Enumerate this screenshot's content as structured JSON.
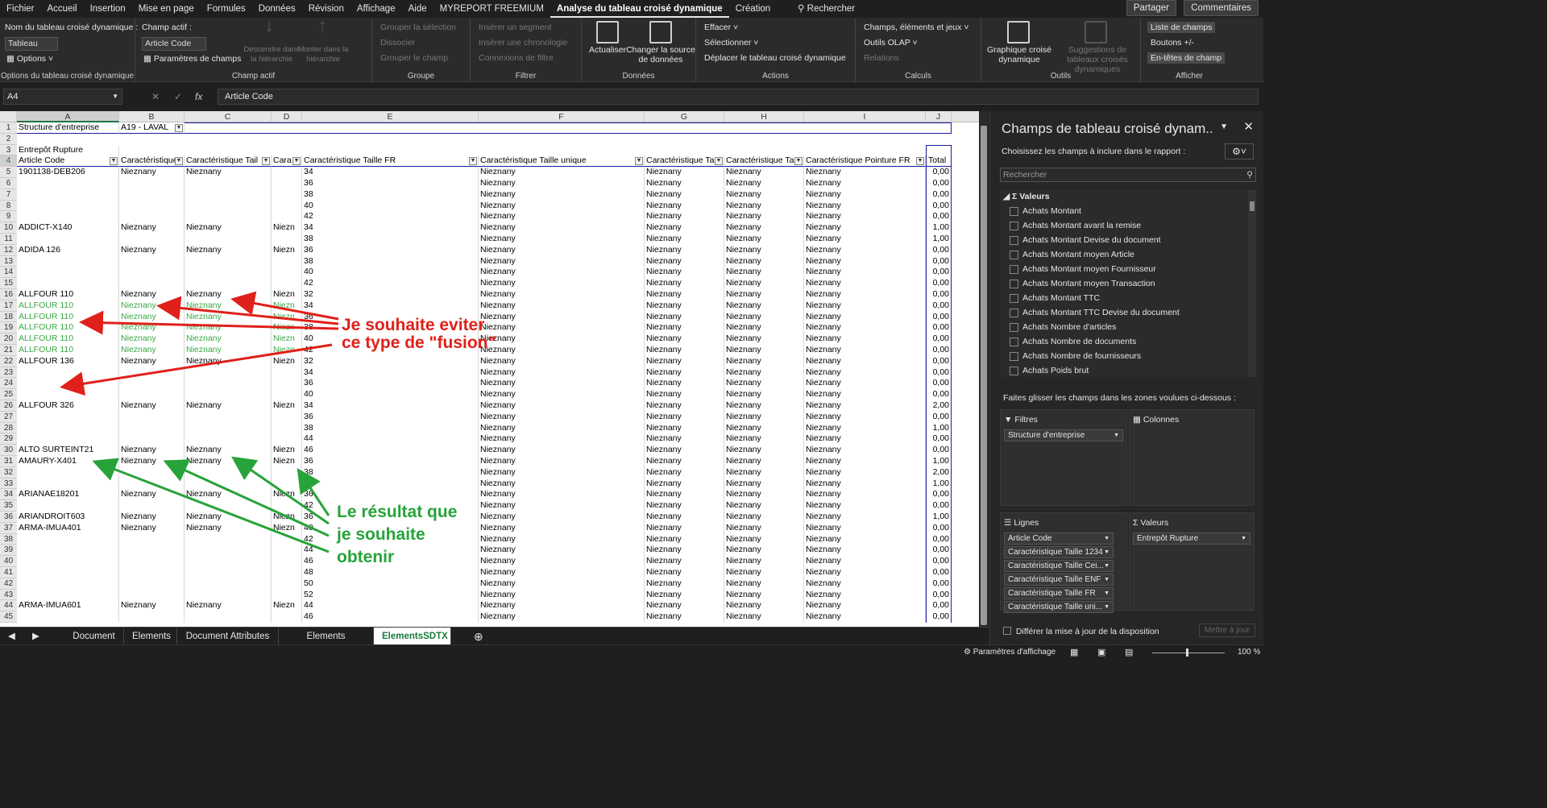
{
  "menu": [
    "Fichier",
    "Accueil",
    "Insertion",
    "Mise en page",
    "Formules",
    "Données",
    "Révision",
    "Affichage",
    "Aide",
    "MYREPORT FREEMIUM",
    "Analyse du tableau croisé dynamique",
    "Création"
  ],
  "menu_active_index": 10,
  "search_label": "Rechercher",
  "share_label": "Partager",
  "comments_label": "Commentaires",
  "ribbon": {
    "pivot_name_label": "Nom du tableau croisé dynamique :",
    "pivot_name_value": "Tableau croisé",
    "options_label": "Options",
    "group1_label": "Options du tableau croisé dynamique",
    "active_field_label": "Champ actif :",
    "active_field_value": "Article Code",
    "field_settings_label": "Paramètres de champs",
    "drill_down_label": "Descendre dans la hiérarchie",
    "drill_up_label": "Monter dans la hiérarchie",
    "group2_label": "Champ actif",
    "group_selection": "Grouper la sélection",
    "ungroup": "Dissocier",
    "group_field": "Grouper le champ",
    "group3_label": "Groupe",
    "insert_slicer": "Insérer un segment",
    "insert_timeline": "Insérer une chronologie",
    "filter_connections": "Connexions de filtre",
    "group4_label": "Filtrer",
    "refresh": "Actualiser",
    "change_source": "Changer la source de données",
    "group5_label": "Données",
    "clear": "Effacer",
    "select": "Sélectionner",
    "move_pivot": "Déplacer le tableau croisé dynamique",
    "group6_label": "Actions",
    "fields_items_sets": "Champs, éléments et jeux",
    "olap_tools": "Outils OLAP",
    "relations": "Relations",
    "group7_label": "Calculs",
    "pivot_chart": "Graphique croisé dynamique",
    "recommended_pivots": "Suggestions de tableaux croisés dynamiques",
    "group8_label": "Outils",
    "field_list": "Liste de champs",
    "buttons_pm": "Boutons +/-",
    "field_headers": "En-têtes de champ",
    "group9_label": "Afficher"
  },
  "formula_bar": {
    "name_box": "A4",
    "formula": "Article Code"
  },
  "columns": [
    "A",
    "B",
    "C",
    "D",
    "E",
    "F",
    "G",
    "H",
    "I",
    "J"
  ],
  "filter_row": {
    "label": "Structure d'entreprise",
    "value": "A19 - LAVAL"
  },
  "values_label": "Entrepôt Rupture",
  "header_row": [
    "Article Code",
    "Caractéristique",
    "Caractéristique Tail",
    "Cara",
    "Caractéristique Taille FR",
    "Caractéristique Taille unique",
    "Caractéristique Ta",
    "Caractéristique Ta",
    "Caractéristique Pointure FR",
    "Total"
  ],
  "rows": [
    {
      "n": 5,
      "a": "1901138-DEB206",
      "b": "Nieznany",
      "c": "Nieznany",
      "d": "",
      "e": "34",
      "f": "Nieznany",
      "g": "Nieznany",
      "h": "Nieznany",
      "i": "Nieznany",
      "t": "0,00"
    },
    {
      "n": 6,
      "a": "",
      "b": "",
      "c": "",
      "d": "",
      "e": "36",
      "f": "Nieznany",
      "g": "Nieznany",
      "h": "Nieznany",
      "i": "Nieznany",
      "t": "0,00"
    },
    {
      "n": 7,
      "a": "",
      "b": "",
      "c": "",
      "d": "",
      "e": "38",
      "f": "Nieznany",
      "g": "Nieznany",
      "h": "Nieznany",
      "i": "Nieznany",
      "t": "0,00"
    },
    {
      "n": 8,
      "a": "",
      "b": "",
      "c": "",
      "d": "",
      "e": "40",
      "f": "Nieznany",
      "g": "Nieznany",
      "h": "Nieznany",
      "i": "Nieznany",
      "t": "0,00"
    },
    {
      "n": 9,
      "a": "",
      "b": "",
      "c": "",
      "d": "",
      "e": "42",
      "f": "Nieznany",
      "g": "Nieznany",
      "h": "Nieznany",
      "i": "Nieznany",
      "t": "0,00"
    },
    {
      "n": 10,
      "a": "ADDICT-X140",
      "b": "Nieznany",
      "c": "Nieznany",
      "d": "Niezn",
      "e": "34",
      "f": "Nieznany",
      "g": "Nieznany",
      "h": "Nieznany",
      "i": "Nieznany",
      "t": "1,00"
    },
    {
      "n": 11,
      "a": "",
      "b": "",
      "c": "",
      "d": "",
      "e": "38",
      "f": "Nieznany",
      "g": "Nieznany",
      "h": "Nieznany",
      "i": "Nieznany",
      "t": "1,00"
    },
    {
      "n": 12,
      "a": "ADIDA 126",
      "b": "Nieznany",
      "c": "Nieznany",
      "d": "Niezn",
      "e": "36",
      "f": "Nieznany",
      "g": "Nieznany",
      "h": "Nieznany",
      "i": "Nieznany",
      "t": "0,00"
    },
    {
      "n": 13,
      "a": "",
      "b": "",
      "c": "",
      "d": "",
      "e": "38",
      "f": "Nieznany",
      "g": "Nieznany",
      "h": "Nieznany",
      "i": "Nieznany",
      "t": "0,00"
    },
    {
      "n": 14,
      "a": "",
      "b": "",
      "c": "",
      "d": "",
      "e": "40",
      "f": "Nieznany",
      "g": "Nieznany",
      "h": "Nieznany",
      "i": "Nieznany",
      "t": "0,00"
    },
    {
      "n": 15,
      "a": "",
      "b": "",
      "c": "",
      "d": "",
      "e": "42",
      "f": "Nieznany",
      "g": "Nieznany",
      "h": "Nieznany",
      "i": "Nieznany",
      "t": "0,00"
    },
    {
      "n": 16,
      "a": "ALLFOUR 110",
      "b": "Nieznany",
      "c": "Nieznany",
      "d": "Niezn",
      "e": "32",
      "f": "Nieznany",
      "g": "Nieznany",
      "h": "Nieznany",
      "i": "Nieznany",
      "t": "0,00"
    },
    {
      "n": 17,
      "a": "ALLFOUR 110",
      "b": "Nieznany",
      "c": "Nieznany",
      "d": "Niezn",
      "e": "34",
      "f": "Nieznany",
      "g": "Nieznany",
      "h": "Nieznany",
      "i": "Nieznany",
      "t": "0,00",
      "green": true
    },
    {
      "n": 18,
      "a": "ALLFOUR 110",
      "b": "Nieznany",
      "c": "Nieznany",
      "d": "Niezn",
      "e": "36",
      "f": "Nieznany",
      "g": "Nieznany",
      "h": "Nieznany",
      "i": "Nieznany",
      "t": "0,00",
      "green": true
    },
    {
      "n": 19,
      "a": "ALLFOUR 110",
      "b": "Nieznany",
      "c": "Nieznany",
      "d": "Niezn",
      "e": "38",
      "f": "Nieznany",
      "g": "Nieznany",
      "h": "Nieznany",
      "i": "Nieznany",
      "t": "0,00",
      "green": true
    },
    {
      "n": 20,
      "a": "ALLFOUR 110",
      "b": "Nieznany",
      "c": "Nieznany",
      "d": "Niezn",
      "e": "40",
      "f": "Nieznany",
      "g": "Nieznany",
      "h": "Nieznany",
      "i": "Nieznany",
      "t": "0,00",
      "green": true
    },
    {
      "n": 21,
      "a": "ALLFOUR 110",
      "b": "Nieznany",
      "c": "Nieznany",
      "d": "Niezn",
      "e": "42",
      "f": "Nieznany",
      "g": "Nieznany",
      "h": "Nieznany",
      "i": "Nieznany",
      "t": "0,00",
      "green": true
    },
    {
      "n": 22,
      "a": "ALLFOUR 136",
      "b": "Nieznany",
      "c": "Nieznany",
      "d": "Niezn",
      "e": "32",
      "f": "Nieznany",
      "g": "Nieznany",
      "h": "Nieznany",
      "i": "Nieznany",
      "t": "0,00"
    },
    {
      "n": 23,
      "a": "",
      "b": "",
      "c": "",
      "d": "",
      "e": "34",
      "f": "Nieznany",
      "g": "Nieznany",
      "h": "Nieznany",
      "i": "Nieznany",
      "t": "0,00"
    },
    {
      "n": 24,
      "a": "",
      "b": "",
      "c": "",
      "d": "",
      "e": "36",
      "f": "Nieznany",
      "g": "Nieznany",
      "h": "Nieznany",
      "i": "Nieznany",
      "t": "0,00"
    },
    {
      "n": 25,
      "a": "",
      "b": "",
      "c": "",
      "d": "",
      "e": "40",
      "f": "Nieznany",
      "g": "Nieznany",
      "h": "Nieznany",
      "i": "Nieznany",
      "t": "0,00"
    },
    {
      "n": 26,
      "a": "ALLFOUR 326",
      "b": "Nieznany",
      "c": "Nieznany",
      "d": "Niezn",
      "e": "34",
      "f": "Nieznany",
      "g": "Nieznany",
      "h": "Nieznany",
      "i": "Nieznany",
      "t": "2,00"
    },
    {
      "n": 27,
      "a": "",
      "b": "",
      "c": "",
      "d": "",
      "e": "36",
      "f": "Nieznany",
      "g": "Nieznany",
      "h": "Nieznany",
      "i": "Nieznany",
      "t": "0,00"
    },
    {
      "n": 28,
      "a": "",
      "b": "",
      "c": "",
      "d": "",
      "e": "38",
      "f": "Nieznany",
      "g": "Nieznany",
      "h": "Nieznany",
      "i": "Nieznany",
      "t": "1,00"
    },
    {
      "n": 29,
      "a": "",
      "b": "",
      "c": "",
      "d": "",
      "e": "44",
      "f": "Nieznany",
      "g": "Nieznany",
      "h": "Nieznany",
      "i": "Nieznany",
      "t": "0,00"
    },
    {
      "n": 30,
      "a": "ALTO SURTEINT21",
      "b": "Nieznany",
      "c": "Nieznany",
      "d": "Niezn",
      "e": "46",
      "f": "Nieznany",
      "g": "Nieznany",
      "h": "Nieznany",
      "i": "Nieznany",
      "t": "0,00"
    },
    {
      "n": 31,
      "a": "AMAURY-X401",
      "b": "Nieznany",
      "c": "Nieznany",
      "d": "Niezn",
      "e": "36",
      "f": "Nieznany",
      "g": "Nieznany",
      "h": "Nieznany",
      "i": "Nieznany",
      "t": "1,00"
    },
    {
      "n": 32,
      "a": "",
      "b": "",
      "c": "",
      "d": "",
      "e": "38",
      "f": "Nieznany",
      "g": "Nieznany",
      "h": "Nieznany",
      "i": "Nieznany",
      "t": "2,00"
    },
    {
      "n": 33,
      "a": "",
      "b": "",
      "c": "",
      "d": "",
      "e": "48",
      "f": "Nieznany",
      "g": "Nieznany",
      "h": "Nieznany",
      "i": "Nieznany",
      "t": "1,00"
    },
    {
      "n": 34,
      "a": "ARIANAE18201",
      "b": "Nieznany",
      "c": "Nieznany",
      "d": "Niezn",
      "e": "36",
      "f": "Nieznany",
      "g": "Nieznany",
      "h": "Nieznany",
      "i": "Nieznany",
      "t": "0,00"
    },
    {
      "n": 35,
      "a": "",
      "b": "",
      "c": "",
      "d": "",
      "e": "42",
      "f": "Nieznany",
      "g": "Nieznany",
      "h": "Nieznany",
      "i": "Nieznany",
      "t": "0,00"
    },
    {
      "n": 36,
      "a": "ARIANDROIT603",
      "b": "Nieznany",
      "c": "Nieznany",
      "d": "Niezn",
      "e": "36",
      "f": "Nieznany",
      "g": "Nieznany",
      "h": "Nieznany",
      "i": "Nieznany",
      "t": "1,00"
    },
    {
      "n": 37,
      "a": "ARMA-IMUA401",
      "b": "Nieznany",
      "c": "Nieznany",
      "d": "Niezn",
      "e": "40",
      "f": "Nieznany",
      "g": "Nieznany",
      "h": "Nieznany",
      "i": "Nieznany",
      "t": "0,00"
    },
    {
      "n": 38,
      "a": "",
      "b": "",
      "c": "",
      "d": "",
      "e": "42",
      "f": "Nieznany",
      "g": "Nieznany",
      "h": "Nieznany",
      "i": "Nieznany",
      "t": "0,00"
    },
    {
      "n": 39,
      "a": "",
      "b": "",
      "c": "",
      "d": "",
      "e": "44",
      "f": "Nieznany",
      "g": "Nieznany",
      "h": "Nieznany",
      "i": "Nieznany",
      "t": "0,00"
    },
    {
      "n": 40,
      "a": "",
      "b": "",
      "c": "",
      "d": "",
      "e": "46",
      "f": "Nieznany",
      "g": "Nieznany",
      "h": "Nieznany",
      "i": "Nieznany",
      "t": "0,00"
    },
    {
      "n": 41,
      "a": "",
      "b": "",
      "c": "",
      "d": "",
      "e": "48",
      "f": "Nieznany",
      "g": "Nieznany",
      "h": "Nieznany",
      "i": "Nieznany",
      "t": "0,00"
    },
    {
      "n": 42,
      "a": "",
      "b": "",
      "c": "",
      "d": "",
      "e": "50",
      "f": "Nieznany",
      "g": "Nieznany",
      "h": "Nieznany",
      "i": "Nieznany",
      "t": "0,00"
    },
    {
      "n": 43,
      "a": "",
      "b": "",
      "c": "",
      "d": "",
      "e": "52",
      "f": "Nieznany",
      "g": "Nieznany",
      "h": "Nieznany",
      "i": "Nieznany",
      "t": "0,00"
    },
    {
      "n": 44,
      "a": "ARMA-IMUA601",
      "b": "Nieznany",
      "c": "Nieznany",
      "d": "Niezn",
      "e": "44",
      "f": "Nieznany",
      "g": "Nieznany",
      "h": "Nieznany",
      "i": "Nieznany",
      "t": "0,00"
    },
    {
      "n": 45,
      "a": "",
      "b": "",
      "c": "",
      "d": "",
      "e": "46",
      "f": "Nieznany",
      "g": "Nieznany",
      "h": "Nieznany",
      "i": "Nieznany",
      "t": "0,00"
    }
  ],
  "annotations": {
    "red_line1": "Je souhaite eviter",
    "red_line2": "ce type de \"fusion\"",
    "green_line1": "Le résultat que",
    "green_line2": "je souhaite",
    "green_line3": "obtenir"
  },
  "sheet_tabs": [
    "Document",
    "Elements",
    "Document Attributes",
    "Elements Attributes",
    "ElementsSDTX"
  ],
  "active_tab_index": 4,
  "status": {
    "view_settings": "Paramètres d'affichage",
    "zoom": "100 %"
  },
  "pane": {
    "title": "Champs de tableau croisé dynam..",
    "subtitle": "Choisissez les champs à inclure dans le rapport :",
    "search_placeholder": "Rechercher",
    "values_group": "Valeurs",
    "fields": [
      "Achats Montant",
      "Achats Montant avant la remise",
      "Achats Montant Devise du document",
      "Achats Montant moyen Article",
      "Achats Montant moyen Fournisseur",
      "Achats Montant moyen Transaction",
      "Achats Montant TTC",
      "Achats Montant TTC Devise du document",
      "Achats Nombre d'articles",
      "Achats Nombre de documents",
      "Achats Nombre de fournisseurs",
      "Achats Poids brut"
    ],
    "drag_hint": "Faites glisser les champs dans les zones voulues ci-dessous :",
    "filters_label": "Filtres",
    "columns_label": "Colonnes",
    "rows_label": "Lignes",
    "values_label": "Valeurs",
    "filter_pills": [
      "Structure d'entreprise"
    ],
    "row_pills": [
      "Article Code",
      "Caractéristique Taille 1234",
      "Caractéristique Taille Cei...",
      "Caractéristique Taille ENF",
      "Caractéristique Taille FR",
      "Caractéristique Taille uni..."
    ],
    "value_pills": [
      "Entrepôt Rupture"
    ],
    "defer_label": "Différer la mise à jour de la disposition",
    "update_label": "Mettre à jour"
  }
}
